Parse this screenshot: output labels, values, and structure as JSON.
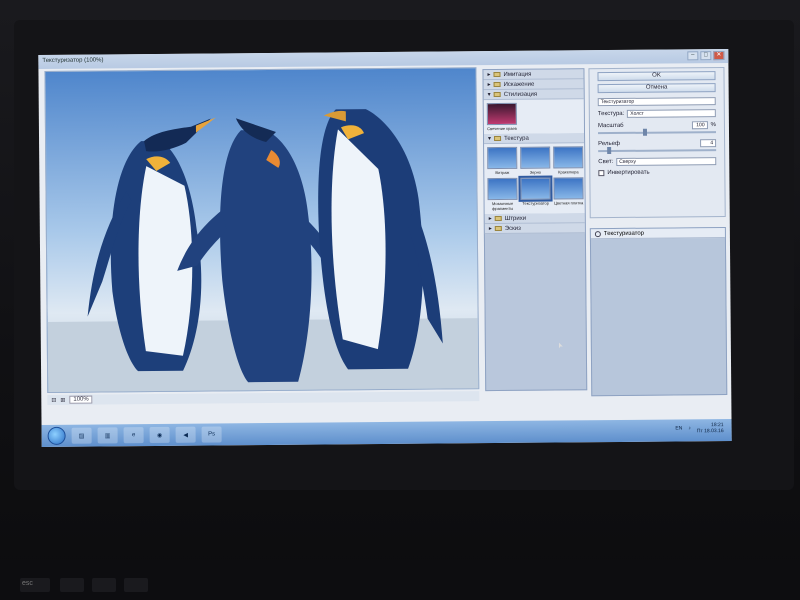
{
  "window": {
    "title": "Текстуризатор (100%)",
    "controls": [
      "–",
      "□",
      "✕"
    ]
  },
  "preview": {
    "image": "penguins-texturized",
    "zoom": "100%"
  },
  "gallery": {
    "categories": [
      {
        "label": "Имитация",
        "expanded": false
      },
      {
        "label": "Искажение",
        "expanded": false
      },
      {
        "label": "Стилизация",
        "expanded": true,
        "items": [
          "Свечение краев"
        ]
      },
      {
        "label": "Текстура",
        "expanded": true,
        "items": [
          "Витраж",
          "Зерно",
          "Кракелюра",
          "Мозаичные фрагменты",
          "Текстуризатор",
          "Цветная плитка"
        ],
        "selected": 4
      },
      {
        "label": "Штрихи",
        "expanded": false
      },
      {
        "label": "Эскиз",
        "expanded": false
      }
    ]
  },
  "settings": {
    "ok_label": "OK",
    "cancel_label": "Отмена",
    "filter_select": "Текстуризатор",
    "texture_label": "Текстура:",
    "texture_value": "Холст",
    "scale_label": "Масштаб",
    "scale_value": "100",
    "scale_unit": "%",
    "relief_label": "Рельеф",
    "relief_value": "4",
    "light_label": "Свет:",
    "light_value": "Сверху",
    "invert_label": "Инвертировать"
  },
  "layers": {
    "items": [
      {
        "label": "Текстуризатор"
      }
    ]
  },
  "taskbar": {
    "apps": [
      "Ps"
    ],
    "lang": "EN",
    "time": "18:21",
    "date": "Пт 18.03.16"
  }
}
